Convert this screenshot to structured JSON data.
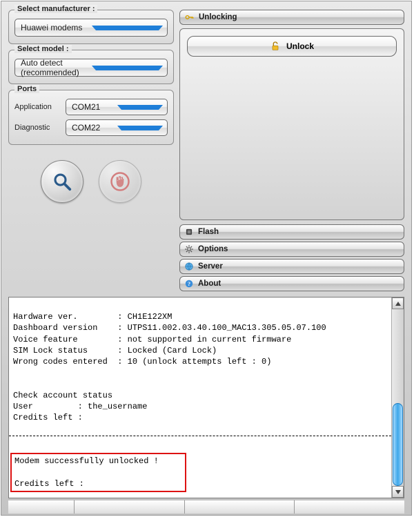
{
  "manufacturer": {
    "label": "Select manufacturer :",
    "value": "Huawei modems"
  },
  "model": {
    "label": "Select model :",
    "value": "Auto detect (recommended)"
  },
  "ports": {
    "label": "Ports",
    "application_label": "Application",
    "application_value": "COM21",
    "diagnostic_label": "Diagnostic",
    "diagnostic_value": "COM22"
  },
  "right": {
    "unlocking_label": "Unlocking",
    "unlock_button": "Unlock",
    "flash_label": "Flash",
    "options_label": "Options",
    "server_label": "Server",
    "about_label": "About"
  },
  "log": {
    "line1": "Hardware ver.        : CH1E122XM",
    "line2": "Dashboard version    : UTPS11.002.03.40.100_MAC13.305.05.07.100",
    "line3": "Voice feature        : not supported in current firmware",
    "line4": "SIM Lock status      : Locked (Card Lock)",
    "line5": "Wrong codes entered  : 10 (unlock attempts left : 0)",
    "line6": "Check account status",
    "line7": "User         : the_username",
    "line8": "Credits left :",
    "line9": "Modem successfully unlocked !",
    "line10": "Credits left :"
  }
}
